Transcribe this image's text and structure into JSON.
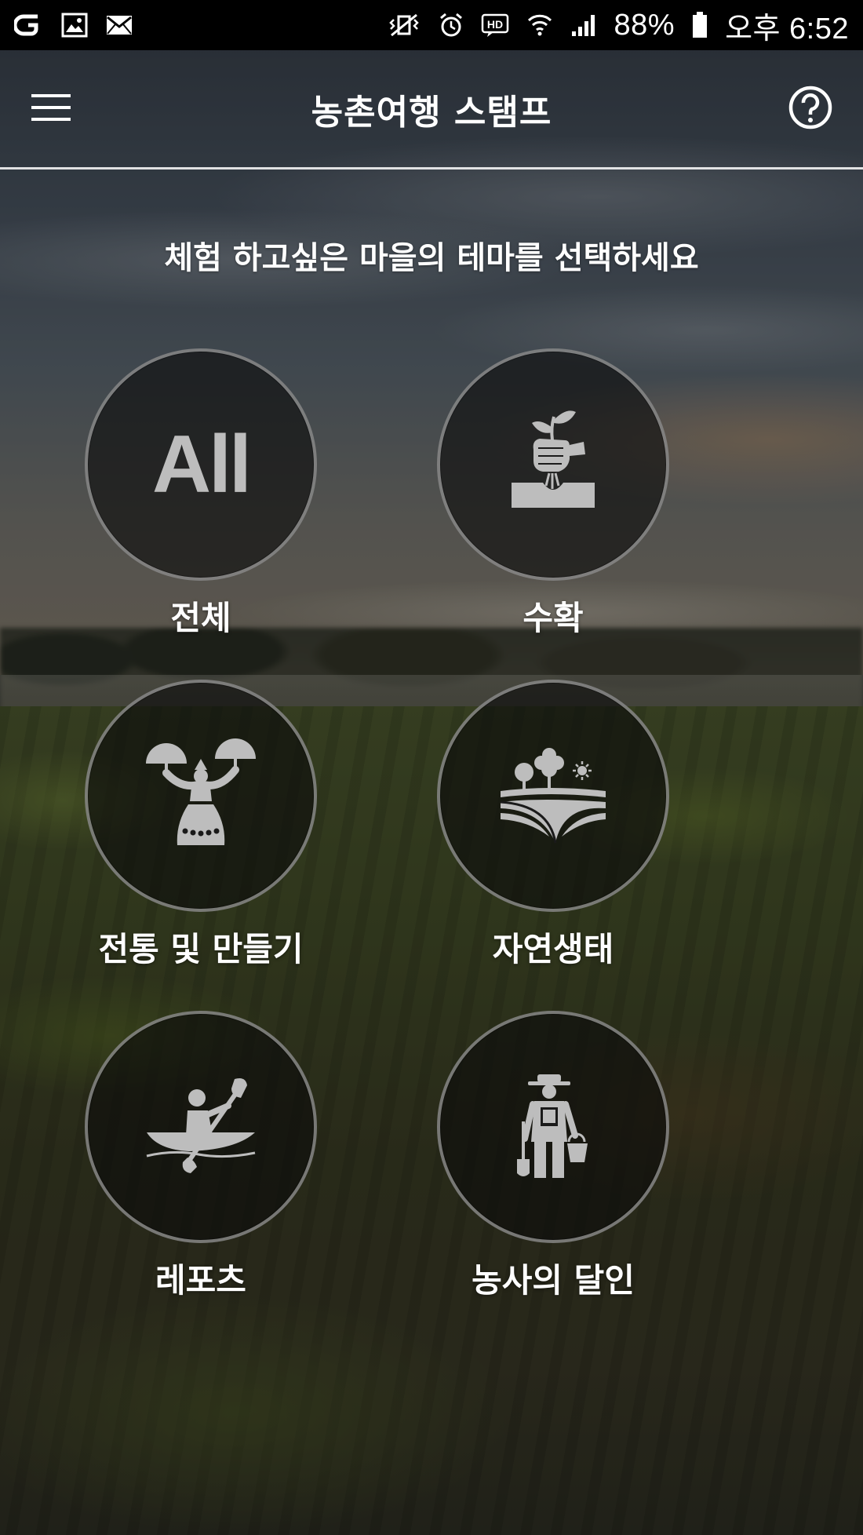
{
  "status_bar": {
    "battery_percent": "88%",
    "time": "오후 6:52",
    "left_icons": [
      "carrier-icon",
      "gallery-icon",
      "mail-icon"
    ],
    "right_icons": [
      "vibrate-icon",
      "alarm-icon",
      "hd-icon",
      "wifi-icon",
      "signal-icon",
      "battery-icon"
    ]
  },
  "app_bar": {
    "title": "농촌여행 스탬프",
    "menu_icon": "hamburger-menu-icon",
    "help_icon": "help-icon"
  },
  "main": {
    "prompt": "체험 하고싶은 마을의 테마를 선택하세요",
    "themes": [
      {
        "label": "전체",
        "icon": "all-icon",
        "icon_text": "All"
      },
      {
        "label": "수확",
        "icon": "plant-harvest-icon"
      },
      {
        "label": "전통 및 만들기",
        "icon": "traditional-dance-icon"
      },
      {
        "label": "자연생태",
        "icon": "nature-field-icon"
      },
      {
        "label": "레포츠",
        "icon": "kayak-icon"
      },
      {
        "label": "농사의 달인",
        "icon": "farmer-icon"
      }
    ]
  },
  "colors": {
    "status_bar_bg": "#000000",
    "circle_fill": "rgba(12,12,12,0.62)",
    "icon_gray": "#bdbdbd",
    "text": "#ffffff"
  }
}
